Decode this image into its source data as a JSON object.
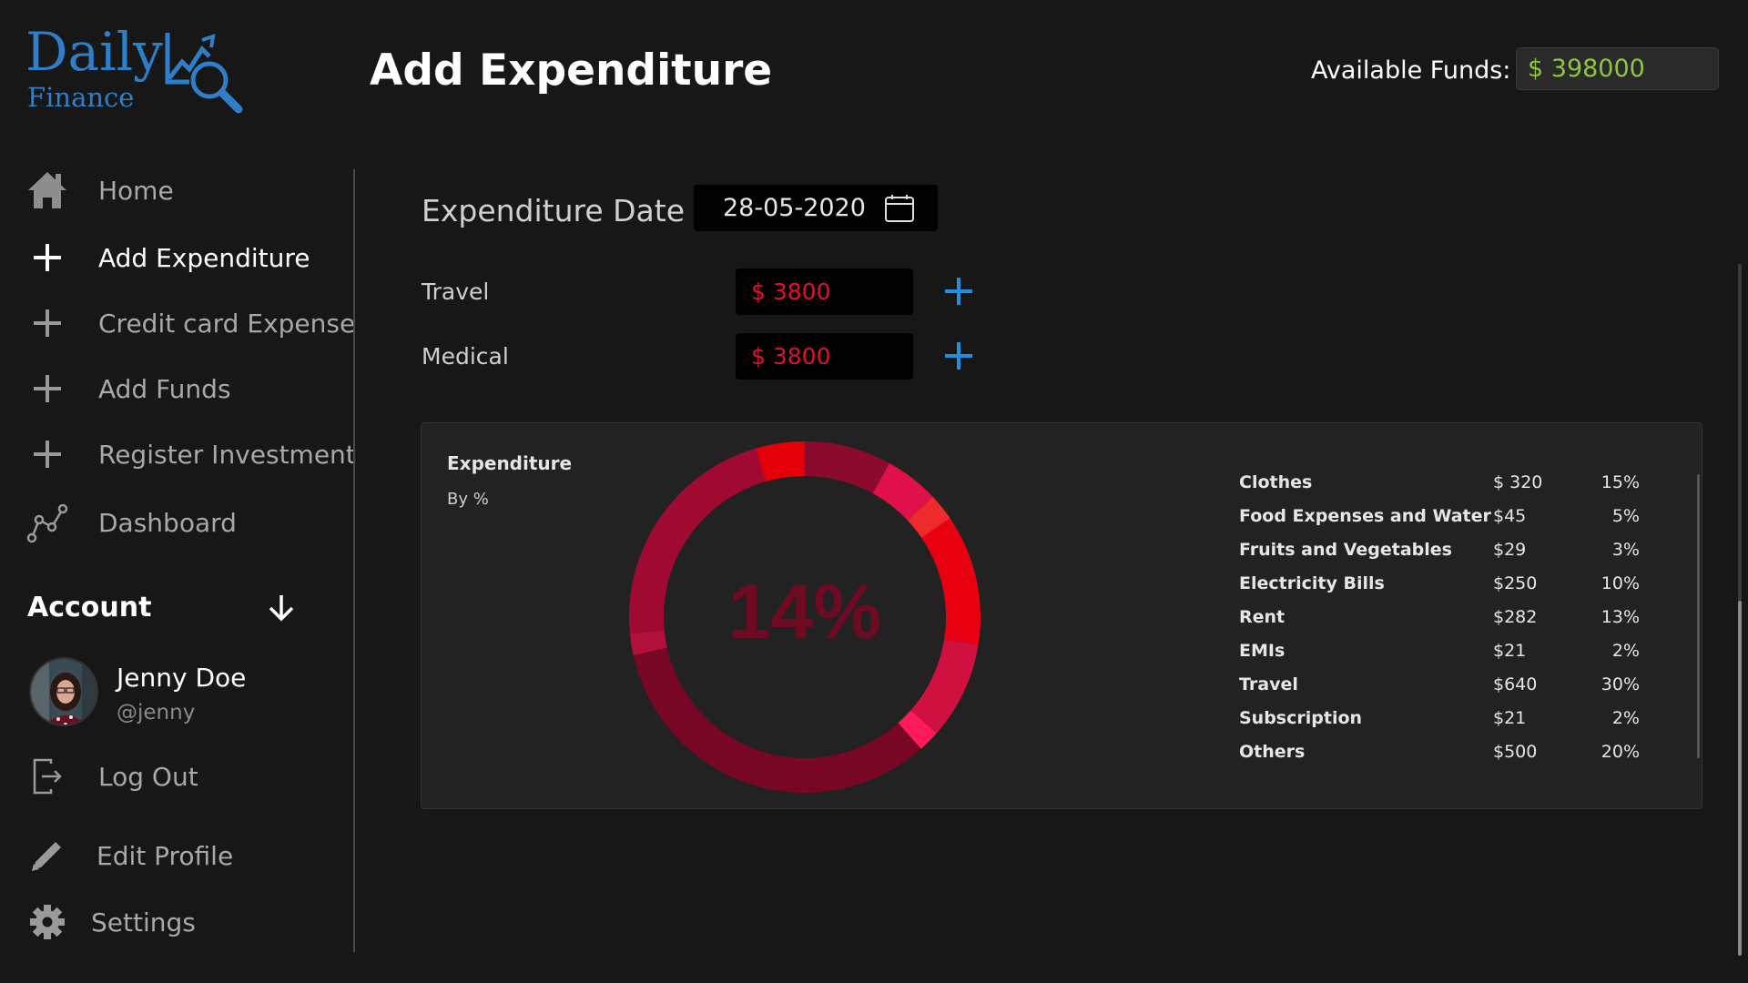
{
  "brand": {
    "name": "Daily",
    "sub": "Finance"
  },
  "header": {
    "title": "Add Expenditure",
    "funds_label": "Available Funds:",
    "funds_value": "$ 398000",
    "funds_color": "#8cc63f"
  },
  "sidebar": {
    "items": [
      {
        "label": "Home",
        "icon": "home-icon"
      },
      {
        "label": "Add Expenditure",
        "icon": "plus-icon",
        "active": true
      },
      {
        "label": "Credit card Expense",
        "icon": "plus-icon"
      },
      {
        "label": "Add Funds",
        "icon": "plus-icon"
      },
      {
        "label": "Register Investment",
        "icon": "plus-icon"
      },
      {
        "label": "Dashboard",
        "icon": "chart-line-icon"
      }
    ],
    "account": {
      "title": "Account",
      "name": "Jenny Doe",
      "handle": "@jenny",
      "logout": "Log Out",
      "edit_profile": "Edit Profile",
      "settings": "Settings"
    }
  },
  "form": {
    "date_label": "Expenditure Date",
    "date_value": "28-05-2020",
    "rows": [
      {
        "label": "Travel",
        "value": "$ 3800"
      },
      {
        "label": "Medical",
        "value": "$ 3800"
      }
    ],
    "accent_add": "#1e90e0",
    "amount_color": "#e0112e"
  },
  "chart_panel": {
    "title": "Expenditure",
    "subtitle": "By %",
    "center_text": "14%"
  },
  "chart_data": {
    "type": "pie",
    "title": "Expenditure",
    "subtitle": "By %",
    "center_label": "14%",
    "slices": [
      {
        "percent": 8,
        "color": "#8b0a2e"
      },
      {
        "percent": 5,
        "color": "#e0114a"
      },
      {
        "percent": 2.5,
        "color": "#f02a2a"
      },
      {
        "percent": 12,
        "color": "#e80010"
      },
      {
        "percent": 9,
        "color": "#d0103e"
      },
      {
        "percent": 2,
        "color": "#ff1a5a"
      },
      {
        "percent": 33,
        "color": "#780625"
      },
      {
        "percent": 2,
        "color": "#b0103a"
      },
      {
        "percent": 22,
        "color": "#a00a32"
      },
      {
        "percent": 4.5,
        "color": "#e40008"
      }
    ],
    "table": [
      {
        "name": "Clothes",
        "amount": "$ 320",
        "percent": "15%"
      },
      {
        "name": "Food Expenses and Water",
        "amount": "$45",
        "percent": "5%"
      },
      {
        "name": "Fruits and Vegetables",
        "amount": "$29",
        "percent": "3%"
      },
      {
        "name": "Electricity Bills",
        "amount": "$250",
        "percent": "10%"
      },
      {
        "name": "Rent",
        "amount": "$282",
        "percent": "13%"
      },
      {
        "name": "EMIs",
        "amount": "$21",
        "percent": "2%"
      },
      {
        "name": "Travel",
        "amount": "$640",
        "percent": "30%"
      },
      {
        "name": "Subscription",
        "amount": "$21",
        "percent": "2%"
      },
      {
        "name": "Others",
        "amount": "$500",
        "percent": "20%"
      }
    ]
  }
}
